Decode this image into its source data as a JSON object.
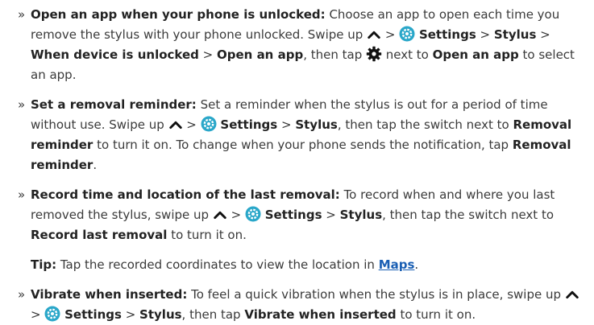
{
  "items": [
    {
      "title": "Open an app when your phone is unlocked:",
      "t1": " Choose an app to open each time you remove the stylus with your phone unlocked. Swipe up ",
      "gt1": " > ",
      "settings": "Settings",
      "gt2": " > ",
      "stylus": "Stylus",
      "gt3": " > ",
      "when_unlocked": "When device is unlocked",
      "gt4": " > ",
      "open_app": "Open an app",
      "t2": ", then tap ",
      "t3": " next to ",
      "open_app2": "Open an app",
      "t4": " to select an app."
    },
    {
      "title": "Set a removal reminder:",
      "t1": " Set a reminder when the stylus is out for a period of time without use. Swipe up ",
      "gt1": " > ",
      "settings": "Settings",
      "gt2": " > ",
      "stylus": "Stylus",
      "t2": ", then tap the switch next to ",
      "removal_reminder": "Removal reminder",
      "t3": " to turn it on. To change when your phone sends the notification, tap ",
      "removal_reminder2": "Removal reminder",
      "t4": "."
    },
    {
      "title": "Record time and location of the last removal:",
      "t1": " To record when and where you last removed the stylus, swipe up ",
      "gt1": " > ",
      "settings": "Settings",
      "gt2": " > ",
      "stylus": "Stylus",
      "t2": ", then tap the switch next to ",
      "record_last": "Record last removal",
      "t3": " to turn it on."
    },
    {
      "title": "Vibrate when inserted:",
      "t1": " To feel a quick vibration when the stylus is in place, swipe up ",
      "gt1": " > ",
      "settings": "Settings",
      "gt2": " > ",
      "stylus": "Stylus",
      "t2": ", then tap ",
      "vibrate": "Vibrate when inserted",
      "t3": " to turn it on."
    }
  ],
  "bullet": "»",
  "tip": {
    "label": "Tip:",
    "text": " Tap the recorded coordinates to view the location in ",
    "link": "Maps",
    "end": "."
  },
  "colors": {
    "text": "#3a3a3a",
    "settings_icon": "#2aa7c9",
    "link": "#1a5fb4"
  },
  "icons": [
    "chevron-up-icon",
    "settings-app-icon",
    "gear-icon"
  ]
}
